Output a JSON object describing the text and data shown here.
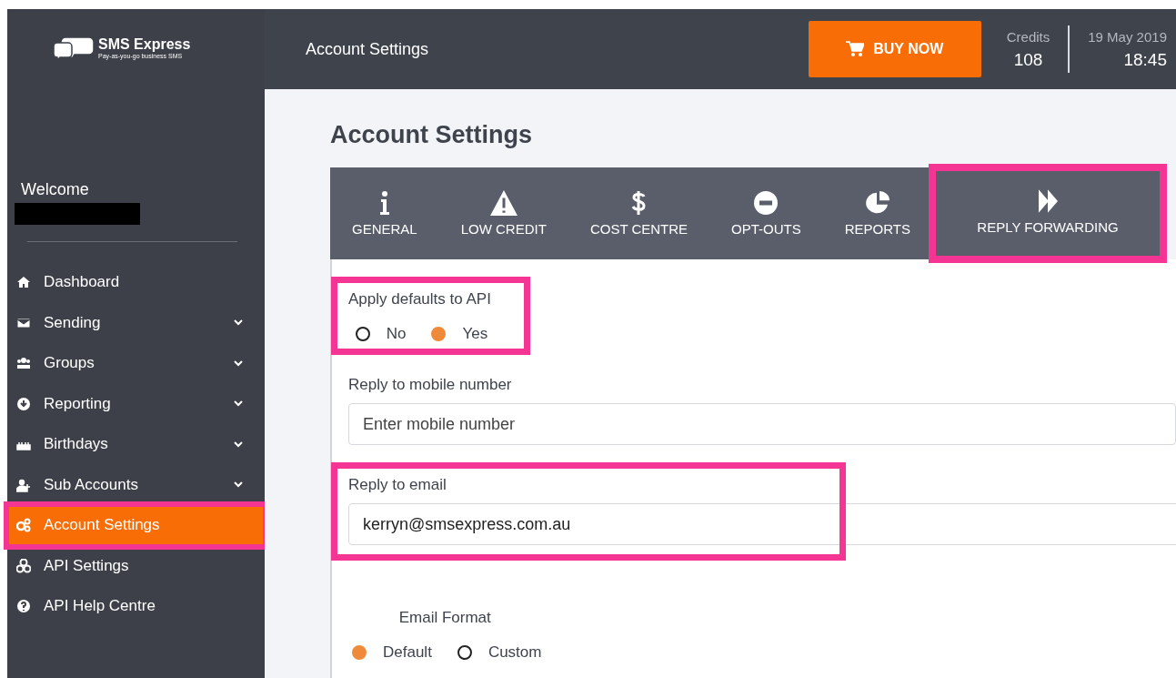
{
  "brand": {
    "name": "SMS Express",
    "tagline": "Pay-as-you-go business SMS"
  },
  "header": {
    "title": "Account Settings",
    "buy_button": "BUY NOW",
    "credits_label": "Credits",
    "credits": "108",
    "date": "19 May 2019",
    "time": "18:45"
  },
  "sidebar": {
    "welcome": "Welcome",
    "items": [
      {
        "label": "Dashboard",
        "has_submenu": false,
        "selected": false,
        "highlighted": false
      },
      {
        "label": "Sending",
        "has_submenu": true,
        "selected": false,
        "highlighted": false
      },
      {
        "label": "Groups",
        "has_submenu": true,
        "selected": false,
        "highlighted": false
      },
      {
        "label": "Reporting",
        "has_submenu": true,
        "selected": false,
        "highlighted": false
      },
      {
        "label": "Birthdays",
        "has_submenu": true,
        "selected": false,
        "highlighted": false
      },
      {
        "label": "Sub Accounts",
        "has_submenu": true,
        "selected": false,
        "highlighted": false
      },
      {
        "label": "Account Settings",
        "has_submenu": false,
        "selected": true,
        "highlighted": true
      },
      {
        "label": "API Settings",
        "has_submenu": false,
        "selected": false,
        "highlighted": false
      },
      {
        "label": "API Help Centre",
        "has_submenu": false,
        "selected": false,
        "highlighted": false
      }
    ]
  },
  "page": {
    "title": "Account Settings"
  },
  "tabs": [
    {
      "label": "GENERAL",
      "selected": false,
      "highlighted": false
    },
    {
      "label": "LOW CREDIT",
      "selected": false,
      "highlighted": false
    },
    {
      "label": "COST CENTRE",
      "selected": false,
      "highlighted": false
    },
    {
      "label": "OPT-OUTS",
      "selected": false,
      "highlighted": false
    },
    {
      "label": "REPORTS",
      "selected": false,
      "highlighted": false
    },
    {
      "label": "REPLY FORWARDING",
      "selected": true,
      "highlighted": true
    }
  ],
  "form": [
    {
      "kind": "radio",
      "label": "Apply defaults to API",
      "highlighted": true,
      "options": [
        {
          "label": "No",
          "selected": false
        },
        {
          "label": "Yes",
          "selected": true
        }
      ]
    },
    {
      "kind": "text",
      "label": "Reply to mobile number",
      "placeholder": "Enter mobile number",
      "highlighted": false
    },
    {
      "kind": "text",
      "label": "Reply to email",
      "value": "kerryn@smsexpress.com.au",
      "highlighted": true
    },
    {
      "kind": "radio",
      "label": "Email Format",
      "highlighted": false,
      "options": [
        {
          "label": "Default",
          "selected": true
        },
        {
          "label": "Custom",
          "selected": false
        }
      ]
    }
  ]
}
